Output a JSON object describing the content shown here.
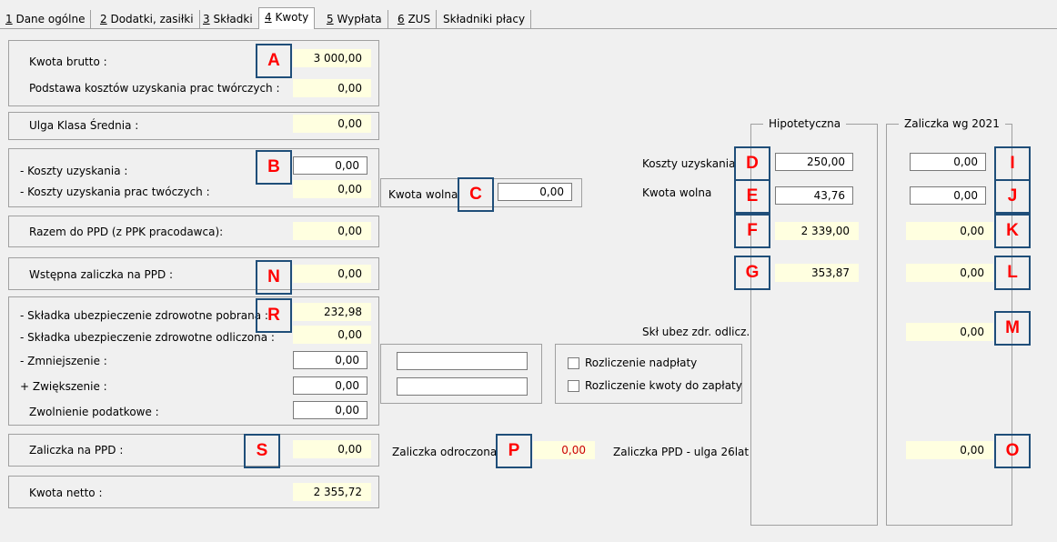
{
  "tabs": [
    {
      "key": "1",
      "label": " Dane ogólne"
    },
    {
      "key": "2",
      "label": " Dodatki, zasiłki"
    },
    {
      "key": "3",
      "label": " Składki"
    },
    {
      "key": "4",
      "label": " Kwoty"
    },
    {
      "key": "5",
      "label": " Wypłata"
    },
    {
      "key": "6",
      "label": " ZUS"
    },
    {
      "key": "",
      "label": "Składniki płacy"
    }
  ],
  "left": {
    "kwota_brutto_label": "Kwota brutto :",
    "kwota_brutto_value": "3 000,00",
    "podstawa_label": "Podstawa kosztów uzyskania prac twórczych :",
    "podstawa_value": "0,00",
    "ulga_label": "Ulga Klasa Średnia :",
    "ulga_value": "0,00",
    "koszty_label": "- Koszty uzyskania :",
    "koszty_value": "0,00",
    "koszty_tworcze_label": "- Koszty uzyskania prac twóczych :",
    "koszty_tworcze_value": "0,00",
    "kwota_wolna_label": "Kwota wolna",
    "kwota_wolna_value": "0,00",
    "razem_label": "Razem do PPD (z PPK pracodawca):",
    "razem_value": "0,00",
    "wstepna_label": "Wstępna zaliczka na PPD :",
    "wstepna_value": "0,00",
    "skladka_pobrana_label": "- Składka ubezpieczenie zdrowotne pobrana :",
    "skladka_pobrana_value": "232,98",
    "skladka_odliczona_label": "- Składka ubezpieczenie zdrowotne odliczona :",
    "skladka_odliczona_value": "0,00",
    "zmniejszenie_label": "- Zmniejszenie :",
    "zmniejszenie_value": "0,00",
    "zwiekszenie_label": "+ Zwiększenie :",
    "zwiekszenie_value": "0,00",
    "zwolnienie_label": "Zwolnienie podatkowe :",
    "zwolnienie_value": "0,00",
    "rozliczenie_nadplaty": "Rozliczenie nadpłaty",
    "rozliczenie_kwoty": "Rozliczenie kwoty do zapłaty",
    "zaliczka_label": "Zaliczka na PPD :",
    "zaliczka_value": "0,00",
    "zaliczka_odroczona_label": "Zaliczka odroczona",
    "zaliczka_odroczona_value": "0,00",
    "kwota_netto_label": "Kwota netto :",
    "kwota_netto_value": "2 355,72"
  },
  "right": {
    "hipotetyczna_title": "Hipotetyczna",
    "zaliczka2021_title": "Zaliczka wg 2021",
    "koszty_label": "Koszty uzyskania",
    "kwota_wolna_label": "Kwota wolna",
    "skl_label": "Skł ubez zdr. odlicz.",
    "ulga26_label": "Zaliczka PPD - ulga 26lat",
    "hip_koszty": "250,00",
    "hip_kwota_wolna": "43,76",
    "hip_f": "2 339,00",
    "hip_g": "353,87",
    "z21_koszty": "0,00",
    "z21_kwota_wolna": "0,00",
    "z21_k": "0,00",
    "z21_l": "0,00",
    "z21_m": "0,00",
    "z21_o": "0,00"
  },
  "markers": {
    "a": "A",
    "b": "B",
    "c": "C",
    "d": "D",
    "e": "E",
    "f": "F",
    "g": "G",
    "i": "I",
    "j": "J",
    "k": "K",
    "l": "L",
    "m": "M",
    "n": "N",
    "o": "O",
    "p": "P",
    "r": "R",
    "s": "S"
  },
  "colors": {
    "background": "#f0f0f0",
    "readonly_field": "#ffffe0",
    "marker_border": "#1f4e79",
    "marker_text": "#ff0000",
    "negative_text": "#cc0000"
  }
}
